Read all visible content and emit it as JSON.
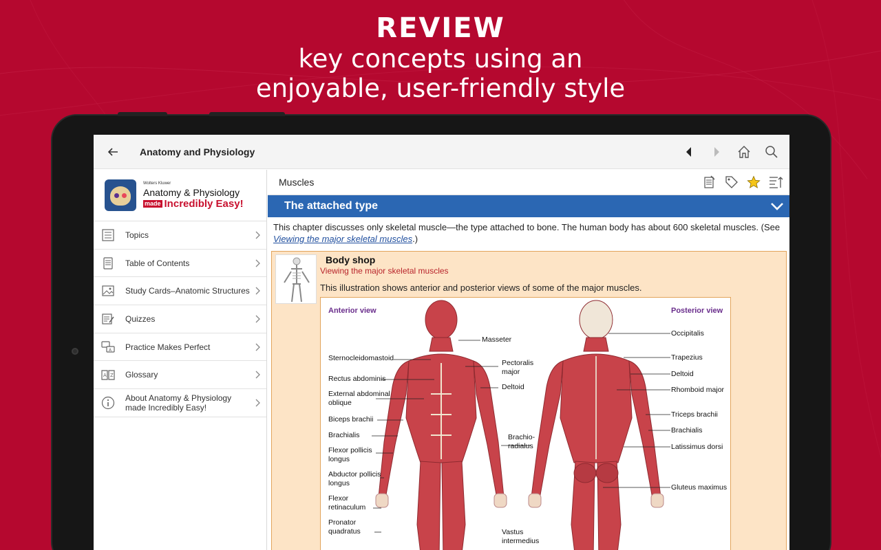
{
  "promo": {
    "line1": "REVIEW",
    "line2": "key concepts using an",
    "line3": "enjoyable, user-friendly style"
  },
  "appbar": {
    "title": "Anatomy and Physiology",
    "icons": [
      "back-arrow-icon",
      "previous-icon",
      "next-icon",
      "home-icon",
      "search-icon"
    ]
  },
  "brand": {
    "publisher": "Wolters Kluwer",
    "name": "Anatomy & Physiology",
    "made": "made",
    "tagline": "Incredibly Easy!"
  },
  "nav": [
    {
      "label": "Topics",
      "icon": "list-icon"
    },
    {
      "label": "Table of Contents",
      "icon": "book-icon"
    },
    {
      "label": "Study Cards–Anatomic Structures",
      "icon": "image-card-icon"
    },
    {
      "label": "Quizzes",
      "icon": "quiz-icon"
    },
    {
      "label": "Practice Makes Perfect",
      "icon": "chat-practice-icon"
    },
    {
      "label": "Glossary",
      "icon": "glossary-icon"
    },
    {
      "label": "About Anatomy & Physiology made Incredibly Easy!",
      "icon": "info-icon"
    }
  ],
  "content": {
    "breadcrumb": "Muscles",
    "section_title": "The attached type",
    "paragraph_before": "This chapter discusses only skeletal muscle—the type attached to bone. The human body has about 600 skeletal muscles. (See ",
    "paragraph_link": "Viewing the major skeletal muscles",
    "paragraph_after": ".)",
    "box": {
      "title": "Body shop",
      "subtitle": "Viewing the major skeletal muscles",
      "description": "This illustration shows anterior and posterior views of some of the major muscles."
    }
  },
  "figure": {
    "anterior_title": "Anterior view",
    "posterior_title": "Posterior view",
    "anterior_left": [
      "Sternocleidomastoid",
      "Rectus abdominis",
      "External abdominal oblique",
      "Biceps brachii",
      "Brachialis",
      "Flexor pollicis longus",
      "Abductor pollicis longus",
      "Flexor retinaculum",
      "Pronator quadratus"
    ],
    "anterior_right": [
      "Masseter",
      "Pectoralis major",
      "Deltoid",
      "Brachio-radialus",
      "Vastus intermedius"
    ],
    "posterior_right": [
      "Occipitalis",
      "Trapezius",
      "Deltoid",
      "Rhomboid major",
      "Triceps brachii",
      "Brachialis",
      "Latissimus dorsi",
      "Gluteus maximus"
    ]
  },
  "colors": {
    "background": "#b5082f",
    "section_bar": "#2b67b3",
    "box_fill": "#fde4c6",
    "accent_red": "#b8242b",
    "star": "#f5c518"
  }
}
